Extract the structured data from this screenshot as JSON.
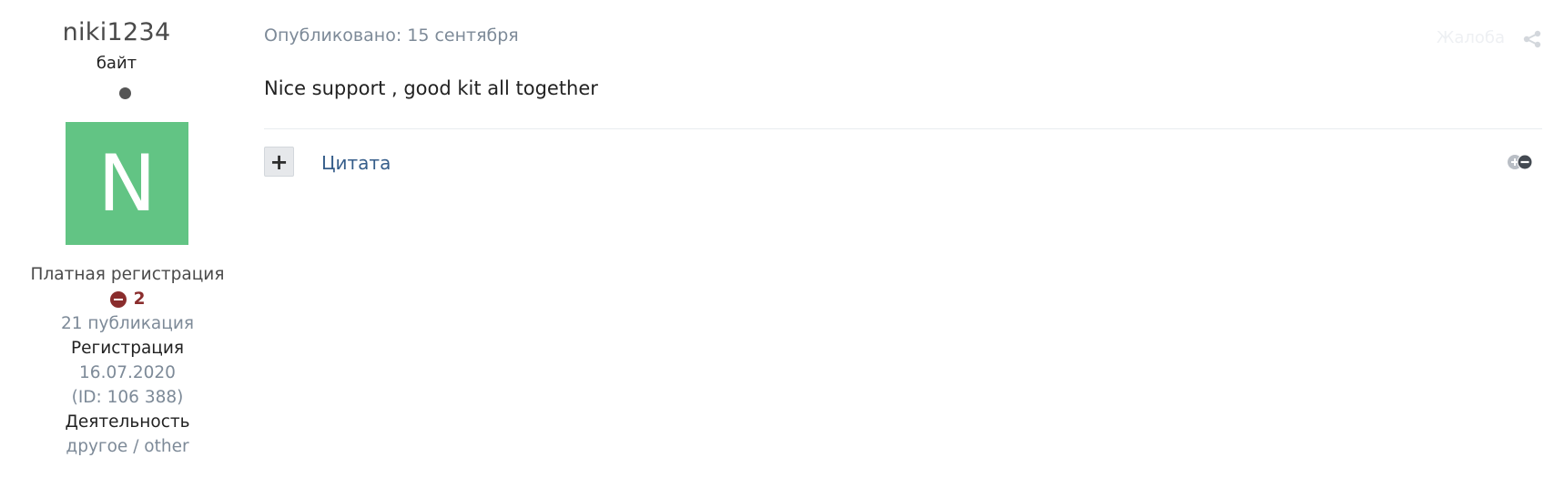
{
  "author": {
    "username": "niki1234",
    "rank_title": "байт",
    "avatar_letter": "N",
    "avatar_color": "#62c484",
    "group": "Платная регистрация",
    "reputation": "2",
    "reputation_icon": "minus-circle-icon",
    "reputation_color": "#8a2d2d",
    "posts": "21 публикация",
    "registration_label": "Регистрация",
    "registration_date": "16.07.2020",
    "member_id": "(ID: 106 388)",
    "activity_label": "Деятельность",
    "activity_value": "другое / other"
  },
  "post": {
    "published": "Опубликовано: 15 сентября",
    "report_label": "Жалоба",
    "share_icon": "share-icon",
    "content": "Nice support , good kit all together",
    "multiquote_label": "+",
    "quote_label": "Цитата",
    "reaction_icon": "reaction-icon"
  }
}
